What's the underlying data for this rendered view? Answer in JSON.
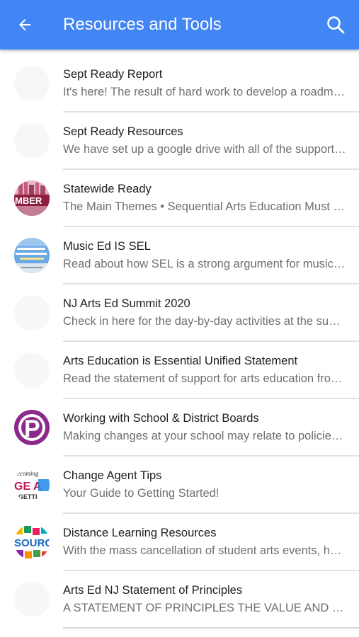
{
  "appbar": {
    "title": "Resources and Tools",
    "back_icon": "arrow-back-icon",
    "search_icon": "search-icon",
    "color": "#4285f4"
  },
  "items": [
    {
      "title": "Sept Ready Report",
      "subtitle": "It's here! The result of hard work to develop a roadmap for reopening schools",
      "avatar": "blank"
    },
    {
      "title": "Sept Ready Resources",
      "subtitle": "We have set up a google drive with all of the supporting resources",
      "avatar": "blank"
    },
    {
      "title": "Statewide Ready",
      "subtitle": "The Main Themes • Sequential Arts Education Must Continue",
      "avatar": "image",
      "avatar_text": "MBER"
    },
    {
      "title": "Music Ed IS SEL",
      "subtitle": "Read about how SEL is a strong argument for music education",
      "avatar": "image"
    },
    {
      "title": "NJ Arts Ed Summit 2020",
      "subtitle": "Check in here for the day-by-day activities at the summit",
      "avatar": "blank"
    },
    {
      "title": "Arts Education is Essential Unified Statement",
      "subtitle": "Read the statement of support for arts education from leading organizations",
      "avatar": "blank"
    },
    {
      "title": "Working with School & District Boards",
      "subtitle": "Making changes at your school may relate to policies set by boards",
      "avatar": "image",
      "avatar_text": "P"
    },
    {
      "title": "Change Agent Tips",
      "subtitle": "Your Guide to Getting Started!",
      "avatar": "image",
      "avatar_text_top": "ecoming",
      "avatar_text_mid": "GE A",
      "avatar_text_bottom": "GETTI"
    },
    {
      "title": "Distance Learning Resources",
      "subtitle": "With the mass cancellation of student arts events, here are resources",
      "avatar": "image",
      "avatar_text": "SOURC"
    },
    {
      "title": "Arts Ed NJ Statement of Principles",
      "subtitle": "A STATEMENT OF PRINCIPLES THE VALUE AND IMPORTANCE OF ARTS EDUCATION",
      "avatar": "blank"
    }
  ]
}
